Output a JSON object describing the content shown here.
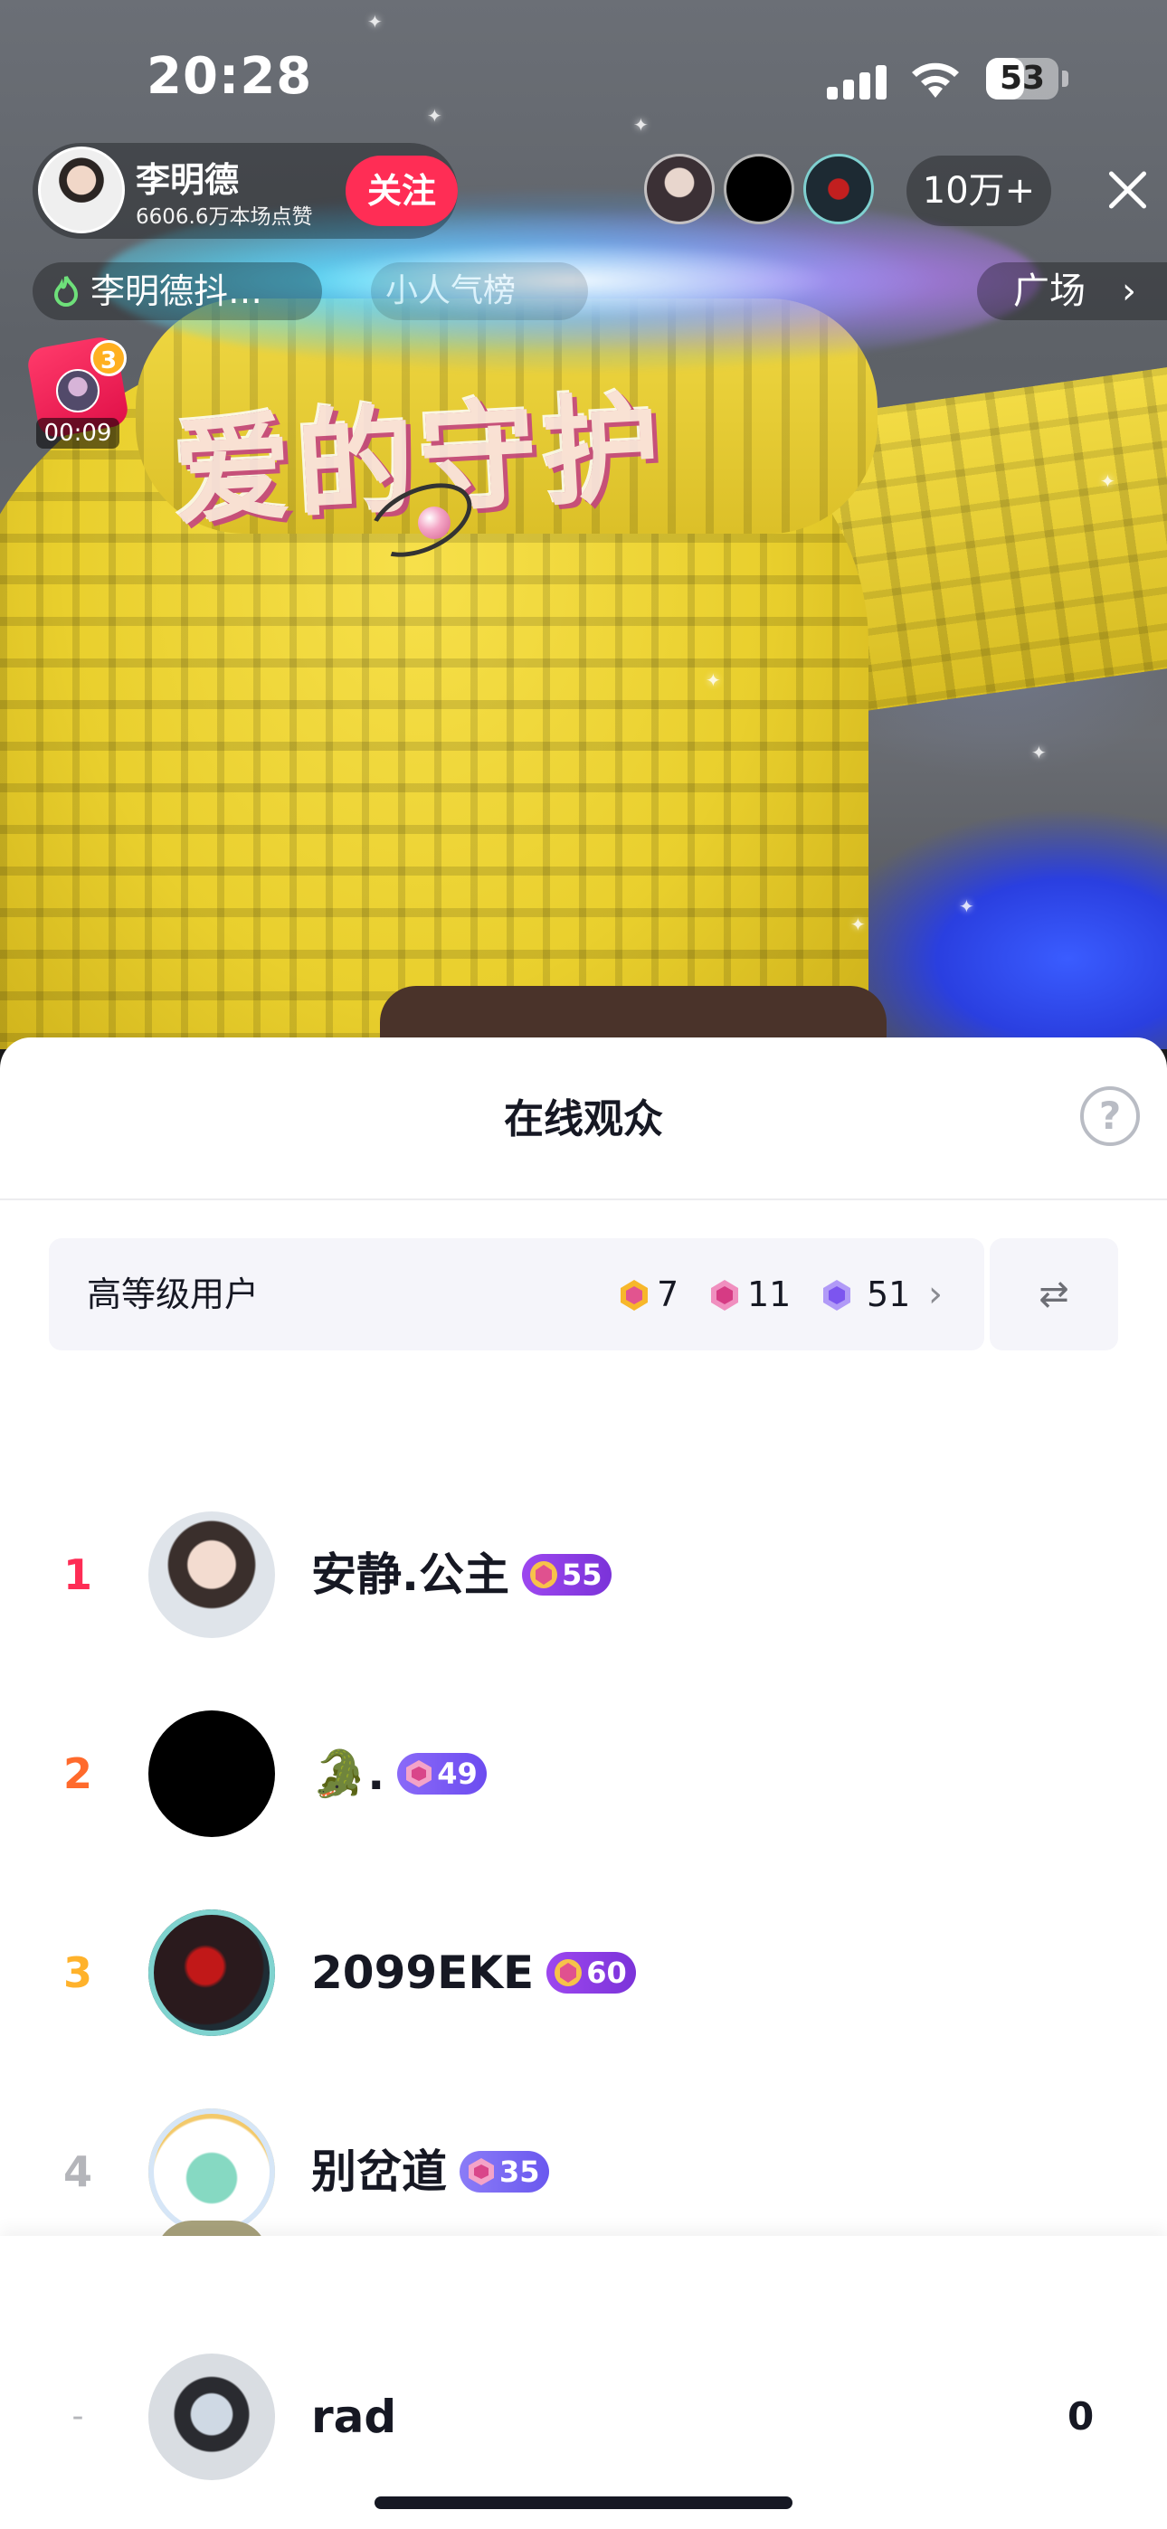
{
  "status_bar": {
    "time": "20:28",
    "battery": "53",
    "battery_fraction": 0.53,
    "icons": [
      "cellular-signal-icon",
      "wifi-icon",
      "battery-icon"
    ]
  },
  "live_header": {
    "host_name": "李明德",
    "host_likes": "6606.6万本场点赞",
    "follow_label": "关注",
    "viewer_count": "10万+",
    "tag_label": "李明德抖…",
    "tag2_label": "小人气榜",
    "plaza_label": "广场",
    "plaza_chevron": "›",
    "gift_count": "3",
    "gift_timer": "00:09",
    "sticker_text": "爱的守护"
  },
  "sheet": {
    "title": "在线观众",
    "help_icon": "?",
    "level_filter": {
      "label": "高等级用户",
      "stats": [
        {
          "icon": "gold-gem-icon",
          "value": "7",
          "color": "#f2b21f"
        },
        {
          "icon": "pink-gem-icon",
          "value": "11",
          "color": "#e8589a"
        },
        {
          "icon": "purple-gem-icon",
          "value": "51",
          "color": "#8a5cf0"
        }
      ],
      "chevron": "›",
      "switch_icon": "⇄"
    },
    "viewers": [
      {
        "rank": "1",
        "rank_color": "#fe2c55",
        "name": "安静.公主",
        "level": "55",
        "badge_color": "#8b3ce6"
      },
      {
        "rank": "2",
        "rank_color": "#ff6a2c",
        "name": "🐊.",
        "level": "49",
        "badge_color": "#7b5cf5"
      },
      {
        "rank": "3",
        "rank_color": "#ffb22b",
        "name": "2099EKE",
        "level": "60",
        "badge_color": "#8b3ce6"
      },
      {
        "rank": "4",
        "rank_color": "#b4b5ba",
        "name": "别岔道",
        "level": "35",
        "badge_color": "#7b6cf5"
      }
    ],
    "self": {
      "rank": "-",
      "name": "rad",
      "score": "0"
    }
  }
}
